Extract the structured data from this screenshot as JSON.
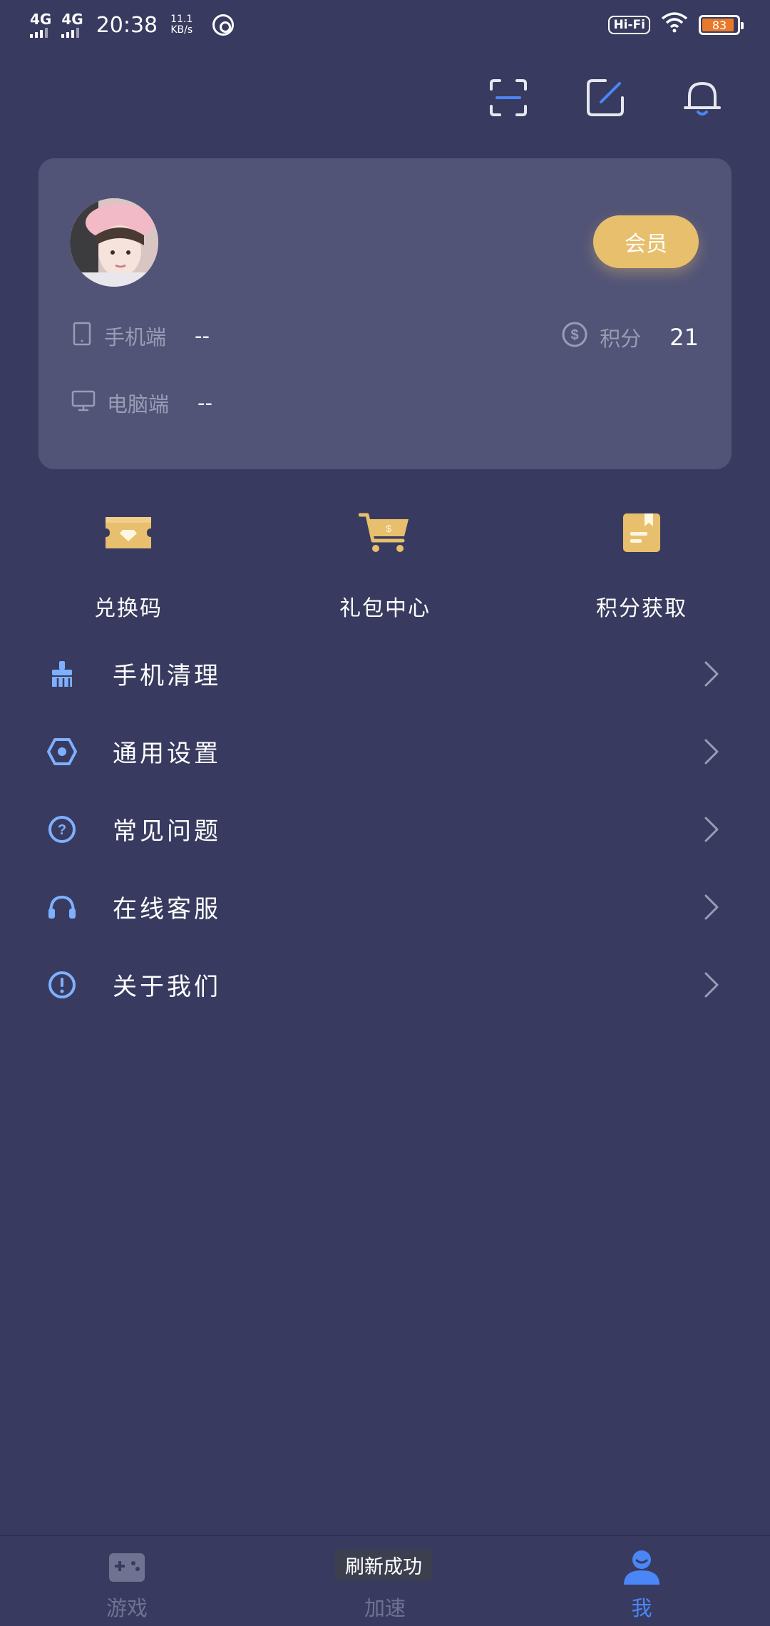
{
  "status_bar": {
    "network_1": "4G",
    "network_2": "4G",
    "time": "20:38",
    "speed_value": "11.1",
    "speed_unit": "KB/s",
    "hifi": "Hi-Fi",
    "battery": "83"
  },
  "top_actions": [
    "scan-icon",
    "edit-icon",
    "bell-icon"
  ],
  "profile": {
    "vip_label": "会员",
    "phone_label": "手机端",
    "phone_value": "--",
    "pc_label": "电脑端",
    "pc_value": "--",
    "points_label": "积分",
    "points_value": "21"
  },
  "quick_actions": [
    {
      "label": "兑换码",
      "icon": "ticket-icon"
    },
    {
      "label": "礼包中心",
      "icon": "cart-icon"
    },
    {
      "label": "积分获取",
      "icon": "notebook-icon"
    }
  ],
  "menu": [
    {
      "label": "手机清理",
      "icon": "broom-icon"
    },
    {
      "label": "通用设置",
      "icon": "settings-icon"
    },
    {
      "label": "常见问题",
      "icon": "question-icon"
    },
    {
      "label": "在线客服",
      "icon": "headset-icon"
    },
    {
      "label": "关于我们",
      "icon": "info-icon"
    }
  ],
  "bottom_nav": [
    {
      "label": "游戏",
      "icon": "gamepad-icon",
      "active": false
    },
    {
      "label": "加速",
      "icon": "rocket-icon",
      "active": false
    },
    {
      "label": "我",
      "icon": "user-icon",
      "active": true
    }
  ],
  "toast": "刷新成功",
  "colors": {
    "background": "#383b5f",
    "card": "#525477",
    "accent_gold": "#e7bf6d",
    "accent_blue": "#4a86f5",
    "menu_icon": "#7fb0ff"
  }
}
